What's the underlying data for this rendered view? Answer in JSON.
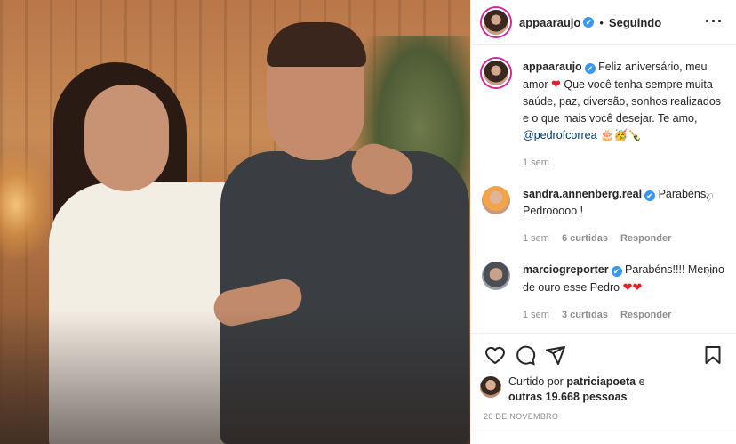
{
  "header": {
    "username": "appaaraujo",
    "verified_mark": "✔",
    "separator": "•",
    "follow_status": "Seguindo",
    "more_label": "···"
  },
  "caption": {
    "username": "appaaraujo",
    "text_part1": "Feliz aniversário, meu amor",
    "text_part2": "Que você tenha sempre muita saúde, paz, diversão, sonhos realizados e o que mais você desejar. Te amo,",
    "mention": "@pedrofcorrea",
    "emojis": "🎂🥳🍾",
    "heart": "❤",
    "time": "1 sem"
  },
  "comments": [
    {
      "username": "sandra.annenberg.real",
      "text": "Parabéns, Pedrooooo !",
      "time": "1 sem",
      "likes": "6 curtidas",
      "reply": "Responder"
    },
    {
      "username": "marciogreporter",
      "text": "Parabéns!!!! Menino de ouro esse Pedro",
      "hearts": "❤❤",
      "time": "1 sem",
      "likes": "3 curtidas",
      "reply": "Responder"
    }
  ],
  "likes": {
    "prefix": "Curtido por",
    "user": "patriciapoeta",
    "suffix": "e",
    "others": "outras 19.668 pessoas"
  },
  "date": "26 DE NOVEMBRO",
  "icons": [
    "heart-icon",
    "comment-icon",
    "share-icon",
    "bookmark-icon",
    "more-icon",
    "small-heart-icon"
  ],
  "colors": {
    "verified": "#3897f0",
    "heart": "#ed1c24",
    "muted": "#8e8e8e",
    "mention": "#00376b"
  }
}
